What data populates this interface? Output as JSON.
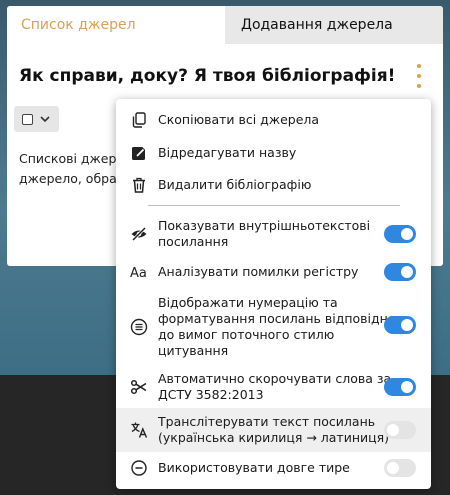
{
  "tabs": [
    {
      "label": "Список джерел",
      "active": true
    },
    {
      "label": "Додавання джерела",
      "active": false
    }
  ],
  "title": "Як справи, доку? Я твоя бібліографія!",
  "body_text": [
    "Спискові джерел",
    "джерело, обрав"
  ],
  "menu": {
    "actions": [
      {
        "label": "Скопіювати всі джерела",
        "icon": "copy-icon"
      },
      {
        "label": "Відредагувати назву",
        "icon": "edit-icon"
      },
      {
        "label": "Видалити бібліографію",
        "icon": "trash-icon"
      }
    ],
    "options": [
      {
        "lines": [
          "Показувати внутрішньотекстові",
          "посилання"
        ],
        "icon": "eye-off-icon",
        "enabled": true
      },
      {
        "lines": [
          "Аналізувати помилки регістру"
        ],
        "icon": "letter-case-icon",
        "enabled": true
      },
      {
        "lines": [
          "Відображати нумерацію та",
          "форматування посилань відповідно",
          "до вимог поточного стилю",
          "цитування"
        ],
        "icon": "numbered-list-icon",
        "enabled": true
      },
      {
        "lines": [
          "Автоматично скорочувати слова за",
          "ДСТУ 3582:2013"
        ],
        "icon": "scissors-icon",
        "enabled": true
      },
      {
        "lines": [
          "Транслітерувати текст посилань",
          "(українська кирилиця → латиниця)"
        ],
        "icon": "translate-icon",
        "enabled": false
      },
      {
        "lines": [
          "Використовувати довге тире"
        ],
        "icon": "dash-circle-icon",
        "enabled": false
      }
    ]
  },
  "colors": {
    "accent": "#d7a15a",
    "toggle_on": "#2f87e0",
    "toggle_off": "#e4e4e4"
  }
}
